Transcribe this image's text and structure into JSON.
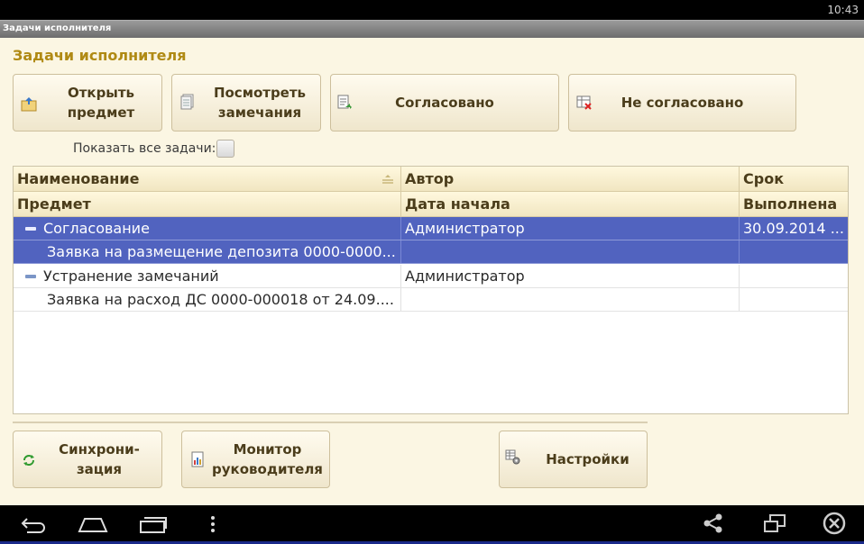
{
  "status_bar": {
    "time": "10:43"
  },
  "window": {
    "title": "Задачи исполнителя"
  },
  "form": {
    "title": "Задачи исполнителя",
    "toolbar": {
      "open_subject": {
        "label": "Открыть\nпредмет",
        "icon": "open-folder-icon"
      },
      "view_remarks": {
        "label": "Посмотреть\nзамечания",
        "icon": "document-icon"
      },
      "agreed": {
        "label": "Согласовано",
        "icon": "document-approve-icon"
      },
      "not_agreed": {
        "label": "Не согласовано",
        "icon": "table-reject-icon"
      }
    },
    "show_all": {
      "label": "Показать все задачи:",
      "checked": false
    }
  },
  "table": {
    "headers_row1": [
      "Наименование",
      "Автор",
      "Срок"
    ],
    "headers_row2": [
      "Предмет",
      "Дата начала",
      "Выполнена"
    ],
    "groups": [
      {
        "name": "Согласование",
        "author": "Администратор",
        "deadline": "30.09.2014 ...",
        "subject": "Заявка на размещение депозита 0000-0000...",
        "start_date": "",
        "done": "",
        "selected": true
      },
      {
        "name": "Устранение замечаний",
        "author": "Администратор",
        "deadline": "",
        "subject": "Заявка на расход ДС 0000-000018 от 24.09....",
        "start_date": "",
        "done": "",
        "selected": false
      }
    ]
  },
  "bottom_toolbar": {
    "sync": {
      "label": "Синхрони-\nзация",
      "icon": "refresh-icon"
    },
    "monitor": {
      "label": "Монитор\nруководителя",
      "icon": "report-chart-icon"
    },
    "settings": {
      "label": "Настройки",
      "icon": "settings-gear-icon"
    }
  },
  "colors": {
    "accent_title": "#b08a14",
    "selection": "#5163bf",
    "background": "#fbf6e3"
  }
}
